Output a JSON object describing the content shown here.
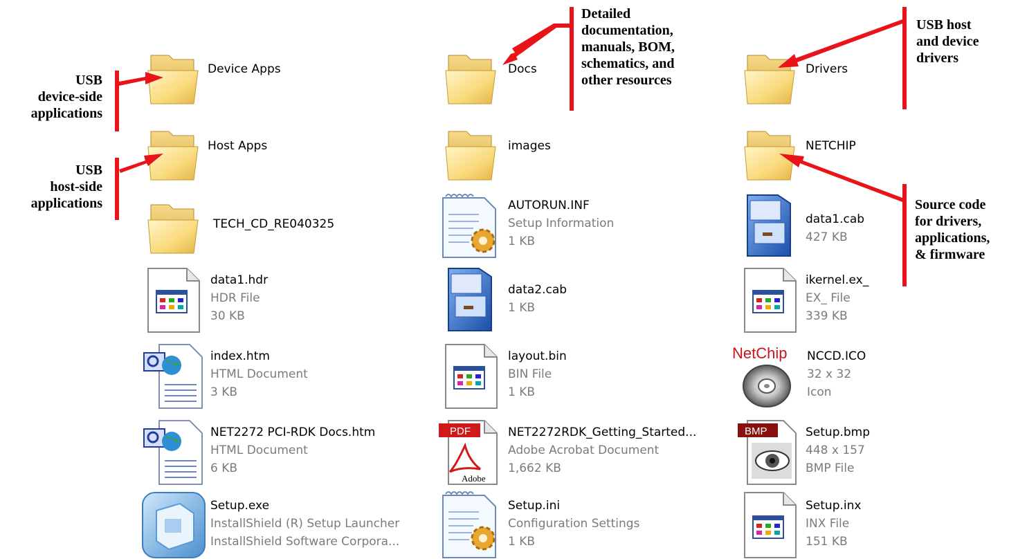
{
  "files": [
    {
      "name": "Device Apps",
      "type": "",
      "size": "",
      "icon": "folder-icon"
    },
    {
      "name": "Docs",
      "type": "",
      "size": "",
      "icon": "folder-icon"
    },
    {
      "name": "Drivers",
      "type": "",
      "size": "",
      "icon": "folder-icon"
    },
    {
      "name": "Host Apps",
      "type": "",
      "size": "",
      "icon": "folder-icon"
    },
    {
      "name": "images",
      "type": "",
      "size": "",
      "icon": "folder-icon"
    },
    {
      "name": "NETCHIP",
      "type": "",
      "size": "",
      "icon": "folder-icon"
    },
    {
      "name": "TECH_CD_RE040325",
      "type": "",
      "size": "",
      "icon": "folder-icon"
    },
    {
      "name": "AUTORUN.INF",
      "type": "Setup Information",
      "size": "1 KB",
      "icon": "setup-info-icon"
    },
    {
      "name": "data1.cab",
      "type": "427 KB",
      "size": "",
      "icon": "cabinet-icon"
    },
    {
      "name": "data1.hdr",
      "type": "HDR File",
      "size": "30 KB",
      "icon": "generic-file-icon"
    },
    {
      "name": "data2.cab",
      "type": "1 KB",
      "size": "",
      "icon": "cabinet-icon"
    },
    {
      "name": "ikernel.ex_",
      "type": "EX_ File",
      "size": "339 KB",
      "icon": "generic-file-icon"
    },
    {
      "name": "index.htm",
      "type": "HTML Document",
      "size": "3 KB",
      "icon": "html-document-icon"
    },
    {
      "name": "layout.bin",
      "type": "BIN File",
      "size": "1 KB",
      "icon": "generic-file-icon"
    },
    {
      "name": "NCCD.ICO",
      "type": "32 x 32",
      "size": "Icon",
      "icon": "netchip-cd-icon"
    },
    {
      "name": "NET2272 PCI-RDK Docs.htm",
      "type": "HTML Document",
      "size": "6 KB",
      "icon": "html-document-icon"
    },
    {
      "name": "NET2272RDK_Getting_Started...",
      "type": "Adobe Acrobat Document",
      "size": "1,662 KB",
      "icon": "pdf-icon"
    },
    {
      "name": "Setup.bmp",
      "type": "448 x 157",
      "size": "BMP File",
      "icon": "bmp-icon"
    },
    {
      "name": "Setup.exe",
      "type": "InstallShield (R) Setup Launcher",
      "size": "InstallShield Software Corpora...",
      "icon": "installshield-icon"
    },
    {
      "name": "Setup.ini",
      "type": "Configuration Settings",
      "size": "1 KB",
      "icon": "setup-info-icon"
    },
    {
      "name": "Setup.inx",
      "type": "INX File",
      "size": "151 KB",
      "icon": "generic-file-icon"
    }
  ],
  "annotations": {
    "device_side": [
      "USB",
      "device-side",
      "applications"
    ],
    "host_side": [
      "USB",
      "host-side",
      "applications"
    ],
    "docs": [
      "Detailed",
      "documentation,",
      "manuals, BOM,",
      "schematics, and",
      "other resources"
    ],
    "drivers": [
      "USB host",
      "and device",
      "drivers"
    ],
    "source": [
      "Source code",
      "for drivers,",
      "applications,",
      "& firmware"
    ]
  },
  "icon_text": {
    "netchip": "NetChip",
    "pdf": "PDF",
    "adobe": "Adobe",
    "bmp": "BMP"
  },
  "colors": {
    "arrow": "#e8141a",
    "folder_light": "#fde9a0",
    "folder_dark": "#e2b44a",
    "cabinet": "#2f63c4",
    "secondary_text": "#7b7b7b"
  }
}
